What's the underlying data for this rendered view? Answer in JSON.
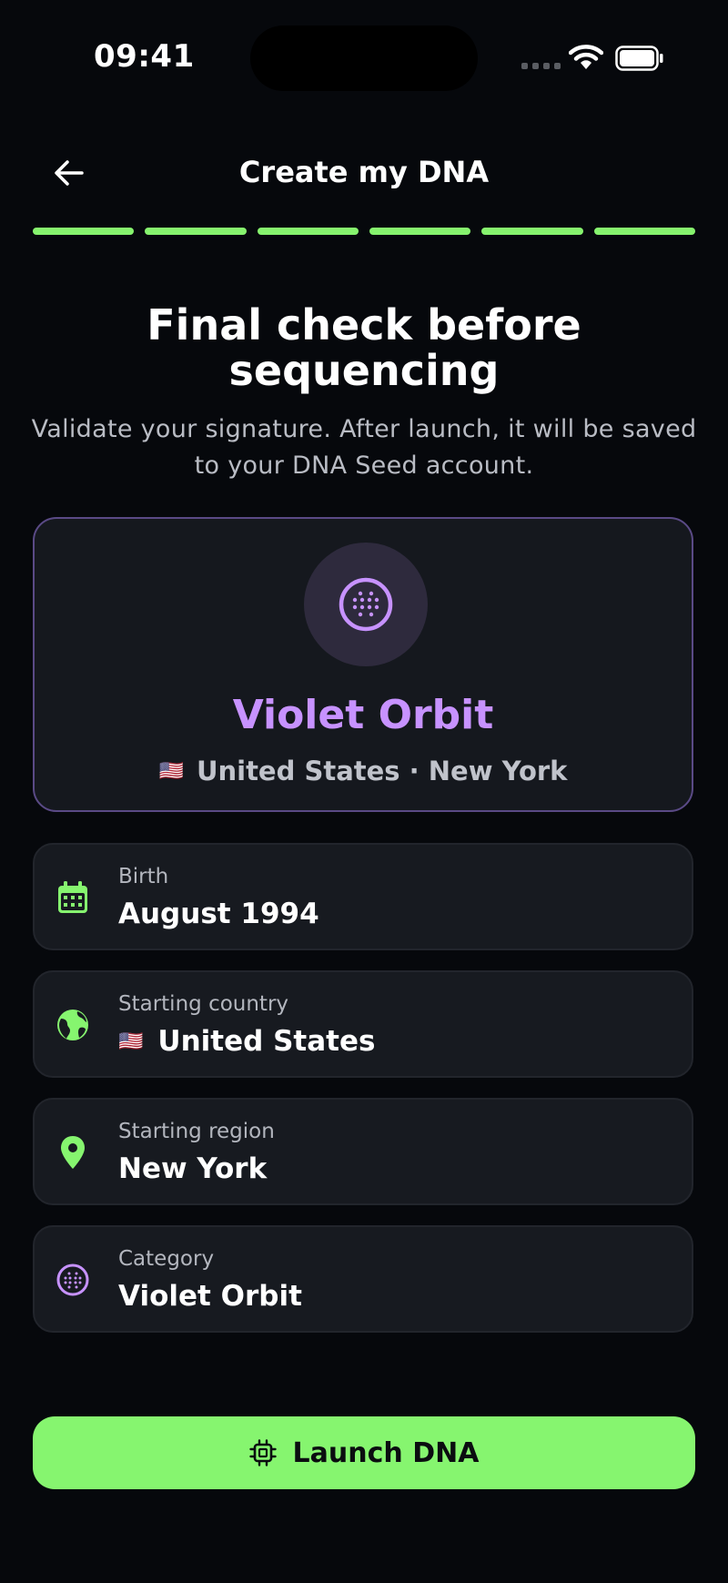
{
  "status_bar": {
    "time": "09:41"
  },
  "header": {
    "title": "Create my DNA",
    "progress_steps_total": 6,
    "progress_steps_done": 6
  },
  "hero": {
    "title": "Final check before sequencing",
    "subtitle": "Validate your signature. After launch, it will be saved to your DNA Seed account."
  },
  "summary": {
    "name": "Violet Orbit",
    "flag": "🇺🇸",
    "location": "United States · New York"
  },
  "details": {
    "birth": {
      "label": "Birth",
      "value": "August 1994",
      "icon": "calendar-icon"
    },
    "country": {
      "label": "Starting country",
      "flag": "🇺🇸",
      "value": "United States",
      "icon": "globe-icon"
    },
    "region": {
      "label": "Starting region",
      "value": "New York",
      "icon": "location-pin-icon"
    },
    "category": {
      "label": "Category",
      "value": "Violet Orbit",
      "icon": "orbit-dots-icon"
    }
  },
  "launch": {
    "label": "Launch DNA",
    "icon": "chip-icon"
  },
  "colors": {
    "accent_green": "#86f56f",
    "accent_violet": "#c792ff",
    "background": "#06080c"
  }
}
